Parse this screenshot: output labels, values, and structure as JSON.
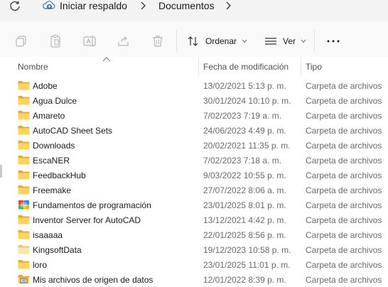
{
  "address": {
    "home_label": "Iniciar respaldo",
    "current_folder": "Documentos"
  },
  "toolbar": {
    "sort_label": "Ordenar",
    "view_label": "Ver"
  },
  "columns": {
    "name": "Nombre",
    "date": "Fecha de modificación",
    "type": "Tipo"
  },
  "files": [
    {
      "name": "Adobe",
      "date": "13/02/2021 5:13 p. m.",
      "type": "Carpeta de archivos",
      "icon": "folder-icon"
    },
    {
      "name": "Agua Dulce",
      "date": "30/01/2024 10:10 p. m.",
      "type": "Carpeta de archivos",
      "icon": "folder-icon"
    },
    {
      "name": "Amareto",
      "date": "7/02/2023 7:19 a. m.",
      "type": "Carpeta de archivos",
      "icon": "folder-icon"
    },
    {
      "name": "AutoCAD Sheet Sets",
      "date": "24/06/2023 4:49 p. m.",
      "type": "Carpeta de archivos",
      "icon": "folder-icon"
    },
    {
      "name": "Downloads",
      "date": "20/02/2021 11:35 p. m.",
      "type": "Carpeta de archivos",
      "icon": "folder-icon"
    },
    {
      "name": "EscaNER",
      "date": "7/02/2023 7:18 a. m.",
      "type": "Carpeta de archivos",
      "icon": "folder-icon"
    },
    {
      "name": "FeedbackHub",
      "date": "9/03/2022 10:55 p. m.",
      "type": "Carpeta de archivos",
      "icon": "folder-icon"
    },
    {
      "name": "Freemake",
      "date": "27/07/2022 8:06 a. m.",
      "type": "Carpeta de archivos",
      "icon": "folder-icon"
    },
    {
      "name": "Fundamentos de programación",
      "date": "23/01/2025 8:01 p. m.",
      "type": "Carpeta de archivos",
      "icon": "colorful-app-folder-icon"
    },
    {
      "name": "Inventor Server for AutoCAD",
      "date": "13/12/2021 4:42 p. m.",
      "type": "Carpeta de archivos",
      "icon": "folder-icon"
    },
    {
      "name": "isaaaaa",
      "date": "22/01/2025 8:56 p. m.",
      "type": "Carpeta de archivos",
      "icon": "folder-icon"
    },
    {
      "name": "KingsoftData",
      "date": "19/12/2023 10:58 p. m.",
      "type": "Carpeta de archivos",
      "icon": "light-folder-icon"
    },
    {
      "name": "loro",
      "date": "23/01/2025 11:01 p. m.",
      "type": "Carpeta de archivos",
      "icon": "folder-icon"
    },
    {
      "name": "Mis archivos de origen de datos",
      "date": "12/01/2022 8:39 p. m.",
      "type": "Carpeta de archivos",
      "icon": "data-sources-folder-icon"
    }
  ]
}
